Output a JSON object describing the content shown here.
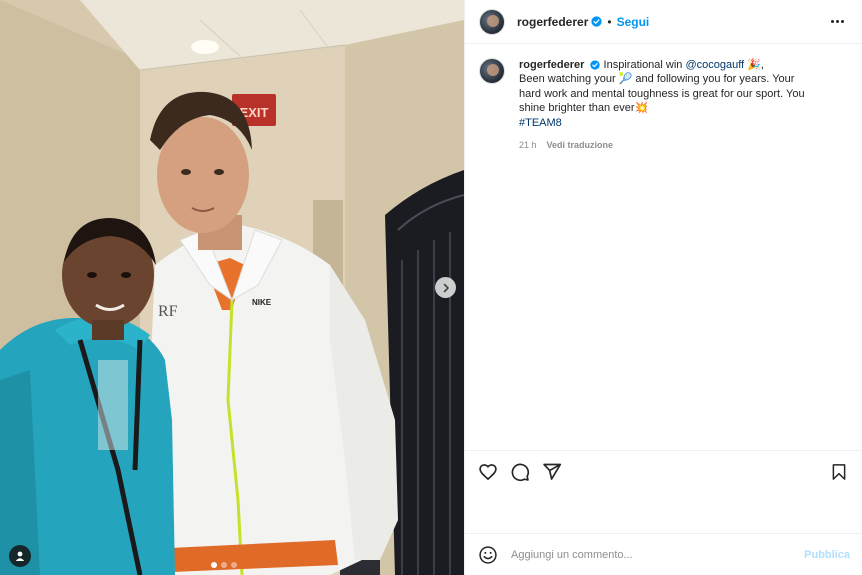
{
  "post": {
    "username": "rogerfederer",
    "follow_label": "Segui",
    "separator": "•"
  },
  "caption": {
    "username": "rogerfederer",
    "line1_text": "Inspirational win ",
    "mention": "@cocogauff",
    "line1_emoji": "🎉,",
    "line2_a": "Been watching your ",
    "tennis_emoji": "🎾",
    "line2_b": " and following you for years. Your hard work and mental toughness is great for our sport. You shine brighter than ever",
    "spark_emoji": "💥",
    "hashtag": "#TEAM8",
    "time": "21 h",
    "translate_label": "Vedi traduzione"
  },
  "comment_box": {
    "placeholder": "Aggiungi un commento...",
    "publish_label": "Pubblica"
  },
  "photo": {
    "exit_sign": "EXIT",
    "jacket_logo": "NIKE",
    "carousel_total": 3,
    "carousel_active": 1
  },
  "colors": {
    "accent": "#0095f6",
    "publish_disabled": "#b2dffc",
    "text": "#262626",
    "muted": "#8e8e8e"
  },
  "icons": {
    "like": "heart-icon",
    "comment": "comment-icon",
    "share": "paper-plane-icon",
    "save": "bookmark-icon",
    "emoji": "smiley-icon",
    "verified": "verified-badge-icon",
    "next": "chevron-right-icon",
    "tag": "user-tag-icon"
  }
}
